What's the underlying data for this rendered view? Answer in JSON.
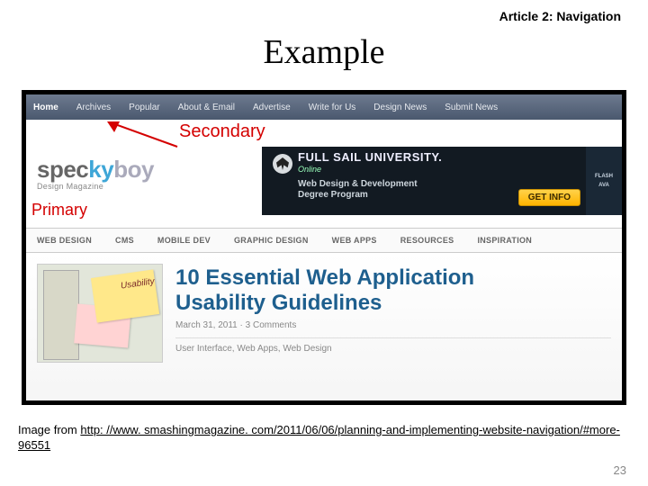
{
  "slide": {
    "header": "Article 2: Navigation",
    "title": "Example",
    "page_number": "23"
  },
  "annotations": {
    "secondary_label": "Secondary",
    "primary_label": "Primary"
  },
  "secondary_nav": {
    "items": [
      "Home",
      "Archives",
      "Popular",
      "About & Email",
      "Advertise",
      "Write for Us",
      "Design News",
      "Submit News"
    ]
  },
  "logo": {
    "part1": "spec",
    "part2": "ky",
    "part3": "boy",
    "subtitle": "Design Magazine"
  },
  "banner": {
    "title": "FULL SAIL UNIVERSITY.",
    "online": "Online",
    "line1": "Web Design & Development",
    "line2": "Degree Program",
    "cta": "GET INFO",
    "side1": "FLASH",
    "side2": "AVA"
  },
  "primary_nav": {
    "items": [
      "WEB DESIGN",
      "CMS",
      "MOBILE DEV",
      "GRAPHIC DESIGN",
      "WEB APPS",
      "RESOURCES",
      "INSPIRATION"
    ]
  },
  "article": {
    "thumb_word": "Usability",
    "title_line1": "10 Essential Web Application",
    "title_line2": "Usability Guidelines",
    "date": "March 31, 2011",
    "comments": "3 Comments",
    "tags": "User Interface, Web Apps, Web Design"
  },
  "caption": {
    "prefix": "Image from ",
    "url_visible": "http: //www. smashingmagazine. com/2011/06/06/planning-and-implementing-website-navigation/#more-96551"
  }
}
